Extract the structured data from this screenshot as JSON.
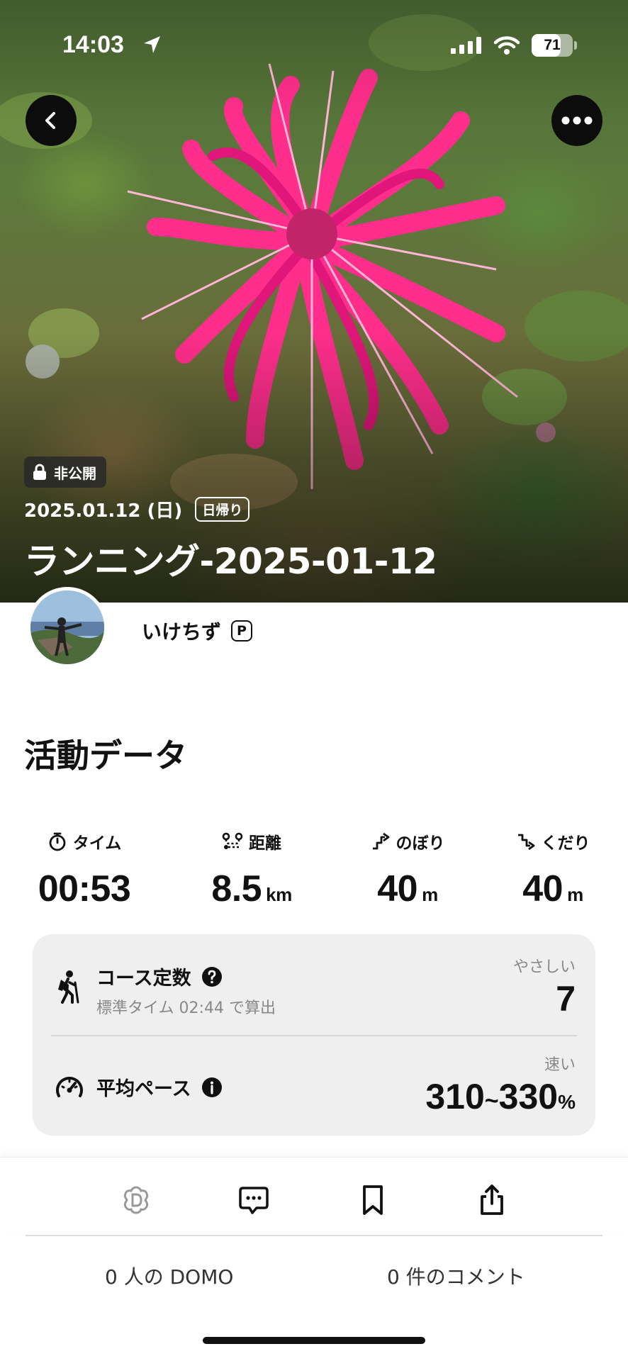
{
  "status_bar": {
    "time": "14:03",
    "battery": "71",
    "battery_level": 0.71
  },
  "hero": {
    "visibility_badge": "非公開",
    "date": "2025.01.12 (日)",
    "trip_type": "日帰り",
    "title": "ランニング-2025-01-12"
  },
  "user": {
    "name": "いけちず",
    "badge": "P"
  },
  "activity": {
    "section_title": "活動データ",
    "stats": [
      {
        "label": "タイム",
        "value": "00:53",
        "unit": "",
        "icon": "stopwatch-icon"
      },
      {
        "label": "距離",
        "value": "8.5",
        "unit": "km",
        "icon": "route-icon"
      },
      {
        "label": "のぼり",
        "value": "40",
        "unit": "m",
        "icon": "ascent-icon"
      },
      {
        "label": "くだり",
        "value": "40",
        "unit": "m",
        "icon": "descent-icon"
      }
    ],
    "course": {
      "title": "コース定数",
      "subtitle": "標準タイム 02:44 で算出",
      "difficulty_label": "やさしい",
      "value": "7"
    },
    "pace": {
      "title": "平均ペース",
      "speed_label": "速い",
      "value_low": "310",
      "separator": "~",
      "value_high": "330",
      "unit": "%"
    }
  },
  "actions": {
    "domo_count": "0 人の DOMO",
    "comment_count": "0 件のコメント"
  },
  "colors": {
    "flower": "#ff2e8c",
    "card_bg": "#efefef",
    "secondary_text": "#888888"
  }
}
